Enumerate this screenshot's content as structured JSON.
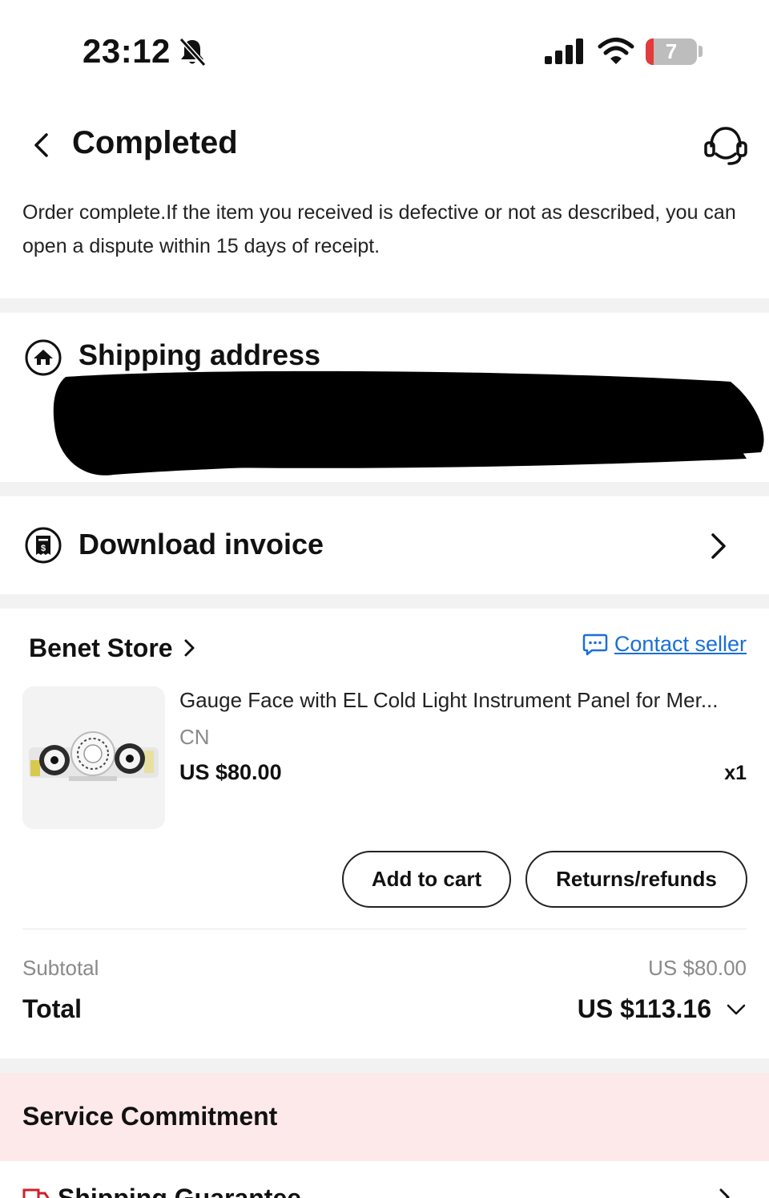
{
  "status_bar": {
    "time": "23:12",
    "battery_percent": "7",
    "icons": [
      "bell-slash-icon",
      "cellular-signal-icon",
      "wifi-icon",
      "battery-icon"
    ]
  },
  "header": {
    "title": "Completed",
    "back_icon": "chevron-left-icon",
    "support_icon": "headset-icon"
  },
  "notice": "Order complete.If the item you received is defective or not as described, you can open a dispute within 15 days of receipt.",
  "shipping": {
    "title": "Shipping address",
    "icon": "home-icon",
    "address_redacted": true
  },
  "invoice": {
    "label": "Download invoice",
    "icon": "invoice-icon"
  },
  "store": {
    "name": "Benet Store",
    "contact_label": "Contact seller",
    "accent_color": "#1a6fd6"
  },
  "product": {
    "title": "Gauge Face with EL Cold Light Instrument Panel for Mer...",
    "origin": "CN",
    "price": "US $80.00",
    "quantity": "x1"
  },
  "actions": {
    "add_to_cart": "Add to cart",
    "returns": "Returns/refunds"
  },
  "summary": {
    "subtotal_label": "Subtotal",
    "subtotal_value": "US $80.00",
    "total_label": "Total",
    "total_value": "US $113.16"
  },
  "service": {
    "title": "Service Commitment",
    "band_color": "#fde8ea",
    "item_label": "Shipping Guarantee"
  }
}
